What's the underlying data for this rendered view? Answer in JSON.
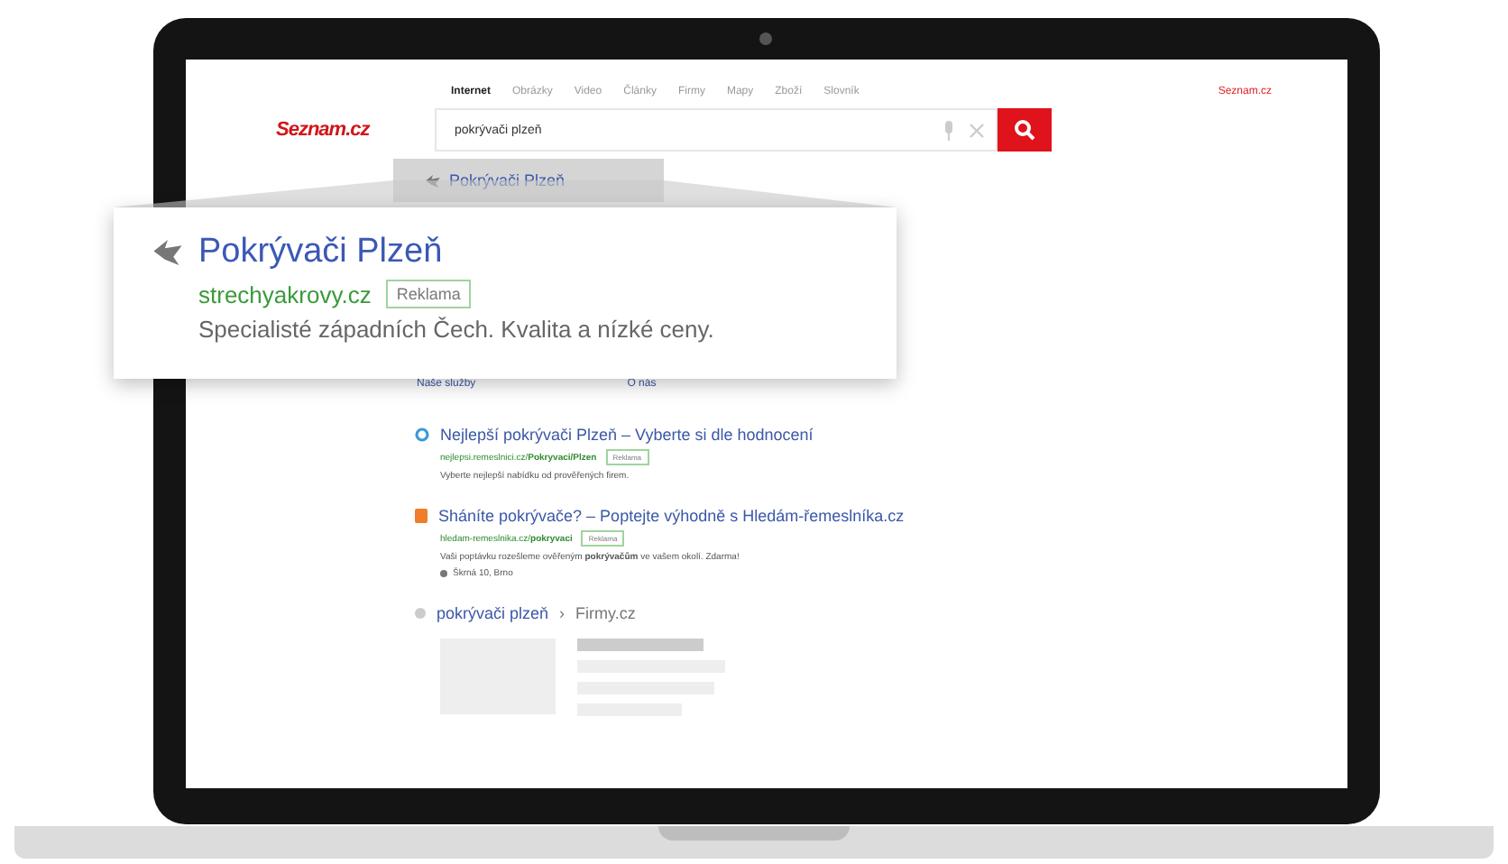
{
  "top_nav": {
    "tabs": [
      {
        "label": "Internet",
        "selected": true
      },
      {
        "label": "Obrázky",
        "selected": false
      },
      {
        "label": "Video",
        "selected": false
      },
      {
        "label": "Články",
        "selected": false
      },
      {
        "label": "Firmy",
        "selected": false
      },
      {
        "label": "Mapy",
        "selected": false
      },
      {
        "label": "Zboží",
        "selected": false
      },
      {
        "label": "Slovník",
        "selected": false
      }
    ],
    "home_link": "Seznam.cz"
  },
  "logo": "Seznam.cz",
  "search": {
    "value": "pokrývači plzeň"
  },
  "sidebar_item": "Pokrývači Plzeň",
  "sitelinks": [
    "Naše služby",
    "O nás"
  ],
  "zoomed_ad": {
    "title": "Pokrývači Plzeň",
    "url": "strechyakrovy.cz",
    "badge": "Reklama",
    "description": "Specialisté západních Čech. Kvalita a nízké ceny."
  },
  "results": [
    {
      "kind": "ad",
      "color": "#3a9ad9",
      "title": "Nejlepší pokrývači Plzeň – Vyberte si dle hodnocení",
      "url": "nejlepsi.remeslnici.cz/**Pokryvaci/Plzen**",
      "badge": "Reklama",
      "description": "Vyberte nejlepší nabídku od prověřených firem."
    },
    {
      "kind": "ad",
      "color": "#f07d2a",
      "title": "Sháníte pokrývače? – Poptejte výhodně s Hledám-řemeslníka.cz",
      "url": "hledam-remeslnika.cz/**pokryvaci**",
      "badge": "Reklama",
      "description": "Vaši poptávku rozešleme ověřeným **pokrývačům** ve vašem okolí. Zdarma!",
      "address": "Škrná 10, Brno"
    },
    {
      "kind": "firmy",
      "color": "#cccccc",
      "query": "pokrývači plzeň",
      "separator": "›",
      "source": "Firmy.cz"
    }
  ]
}
